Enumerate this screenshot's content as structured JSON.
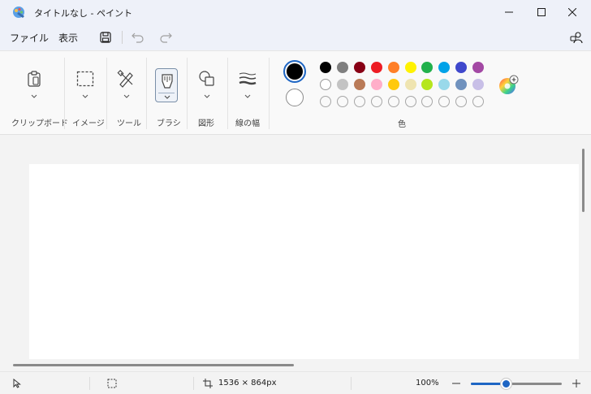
{
  "window": {
    "title": "タイトルなし - ペイント"
  },
  "menu": {
    "file": "ファイル",
    "view": "表示"
  },
  "ribbon": {
    "groups": {
      "clipboard": "クリップボード",
      "image": "イメージ",
      "tools": "ツール",
      "brush": "ブラシ",
      "shapes": "図形",
      "line_width": "線の幅",
      "colors": "色"
    },
    "colors": {
      "primary": "#000000",
      "secondary": "#ffffff",
      "row1": [
        "#000000",
        "#7f7f7f",
        "#880015",
        "#ed1c24",
        "#ff7f27",
        "#fff200",
        "#22b14c",
        "#00a2e8",
        "#3f48cc",
        "#a349a4"
      ],
      "row2": [
        "#ffffff",
        "#c3c3c3",
        "#b97a57",
        "#ffaec9",
        "#ffc90e",
        "#efe4b0",
        "#b5e61d",
        "#99d9ea",
        "#7092be",
        "#c8bfe7"
      ],
      "row3_empty_count": 10
    }
  },
  "status": {
    "canvas_size": "1536 × 864px",
    "zoom": "100%",
    "zoom_fraction": 0.38
  },
  "icons": {
    "app": "paint-app-icon",
    "save": "save-icon",
    "undo": "undo-icon",
    "redo": "redo-icon",
    "profile": "profile-icon"
  }
}
